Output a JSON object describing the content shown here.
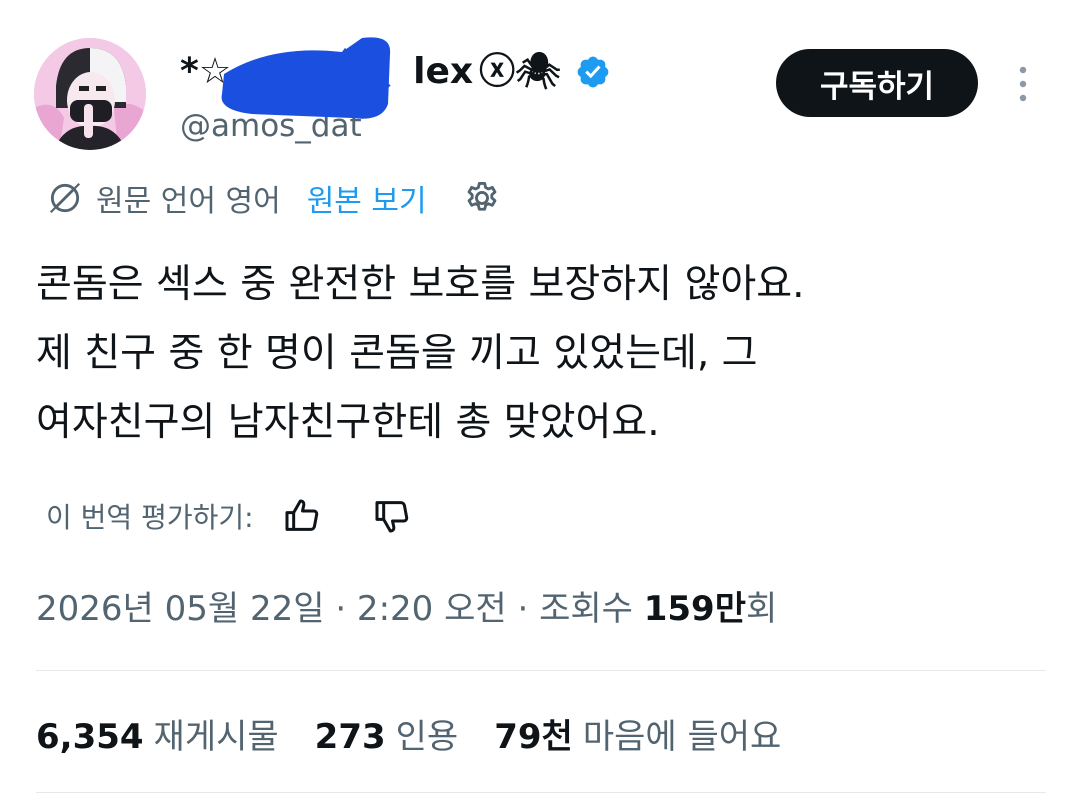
{
  "author": {
    "display_name_prefix": "*☆",
    "display_name_suffix": "lex",
    "emoji_symbols": "ⓧ🕷",
    "handle": "@amos_dat",
    "verified": true
  },
  "subscribe_label": "구독하기",
  "translation": {
    "source_language_label": "원문 언어 영어",
    "show_original_label": "원본 보기"
  },
  "tweet_lines": [
    "콘돔은 섹스 중 완전한 보호를 보장하지 않아요.",
    "제 친구 중 한 명이 콘돔을 끼고 있었는데, 그",
    "여자친구의 남자친구한테 총 맞았어요."
  ],
  "rating_label": "이 번역 평가하기:",
  "meta": {
    "datetime": "2026년 05월 22일 · 2:20 오전 · 조회수 ",
    "views_number": "159만",
    "views_suffix": "회"
  },
  "stats": {
    "reposts_count": "6,354",
    "reposts_label": "재게시물",
    "quotes_count": "273",
    "quotes_label": "인용",
    "likes_count": "79천",
    "likes_label": "마음에 들어요"
  },
  "colors": {
    "link": "#1d9bf0",
    "secondary_text": "#536471",
    "primary_text": "#0f1419",
    "redaction": "#1a4fe0"
  },
  "icons": [
    "translate-icon",
    "gear-icon",
    "thumbs-up-icon",
    "thumbs-down-icon",
    "more-icon",
    "verified-badge-icon"
  ]
}
